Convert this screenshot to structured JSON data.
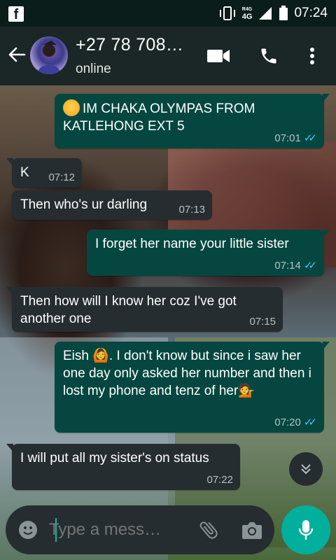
{
  "status_bar": {
    "time": "07:24",
    "network": "4G",
    "network_small": "R4G"
  },
  "header": {
    "contact": "+27 78 708…",
    "status": "online"
  },
  "messages": [
    {
      "dir": "out",
      "emoji": "smile",
      "text": "IM CHAKA OLYMPAS FROM KATLEHONG EXT 5",
      "time": "07:01",
      "read": true
    },
    {
      "dir": "in",
      "text": "K",
      "time": "07:12"
    },
    {
      "dir": "in",
      "text": "Then who's ur darling",
      "time": "07:13"
    },
    {
      "dir": "out",
      "text": "I forget her name  your little sister",
      "time": "07:14",
      "read": true
    },
    {
      "dir": "in",
      "text": "Then how will I know her coz I've got another one",
      "time": "07:15"
    },
    {
      "dir": "out",
      "text": "Eish 🙆. I don't know  but since i saw her one day only asked her number and then i lost my phone and tenz of her💁",
      "time": "07:20",
      "read": true
    },
    {
      "dir": "in",
      "text": "I will put all my sister's on status",
      "time": "07:22"
    }
  ],
  "input": {
    "placeholder": "Type a mess…"
  },
  "colors": {
    "incoming_bubble": "#262d31",
    "outgoing_bubble": "#054740",
    "accent": "#00af9c",
    "read_ticks": "#4fc3f7"
  }
}
